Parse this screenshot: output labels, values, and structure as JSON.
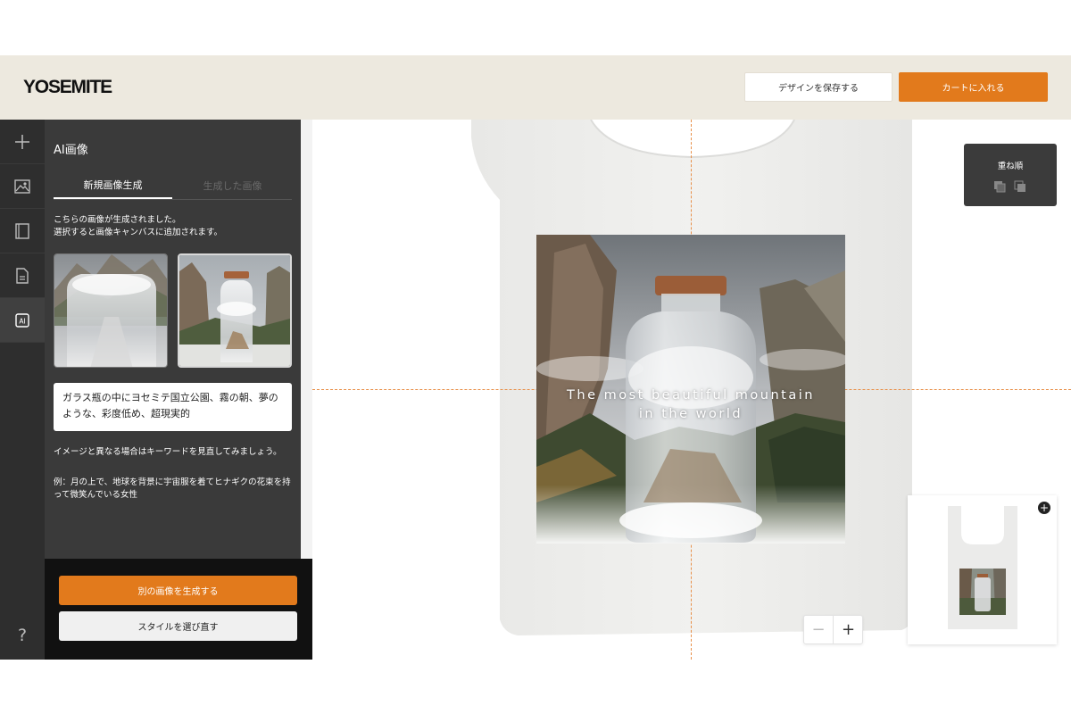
{
  "header": {
    "logo": "YOSEMITE",
    "save_label": "デザインを保存する",
    "cart_label": "カートに入れる"
  },
  "rail": {
    "items": [
      {
        "icon": "plus-icon"
      },
      {
        "icon": "image-icon"
      },
      {
        "icon": "book-icon"
      },
      {
        "icon": "document-icon"
      },
      {
        "icon": "ai-icon",
        "label": "AI"
      }
    ],
    "help": "?"
  },
  "panel": {
    "title": "AI画像",
    "tabs": [
      {
        "label": "新規画像生成",
        "active": true
      },
      {
        "label": "生成した画像",
        "active": false
      }
    ],
    "description_line1": "こちらの画像が生成されました。",
    "description_line2": "選択すると画像キャンバスに追加されます。",
    "prompt": "ガラス瓶の中にヨセミテ国立公園、霧の朝、夢のような、彩度低め、超現実的",
    "hint": "イメージと異なる場合はキーワードを見直してみましょう。",
    "example": "例：月の上で、地球を背景に宇宙服を着てヒナギクの花束を持って微笑んでいる女性",
    "regenerate_label": "別の画像を生成する",
    "choose_style_label": "スタイルを選び直す"
  },
  "canvas": {
    "design_text_line1": "The most beautiful mountain",
    "design_text_line2": "in the world",
    "layer_order_title": "重ね順",
    "zoom_out": "−",
    "zoom_in": "+",
    "preview_add": "+"
  },
  "colors": {
    "accent": "#e27a1c",
    "header_bg": "#ede9df",
    "rail_bg": "#2e2e2e",
    "panel_bg": "#3a3a3a",
    "guide": "#e8904a"
  }
}
